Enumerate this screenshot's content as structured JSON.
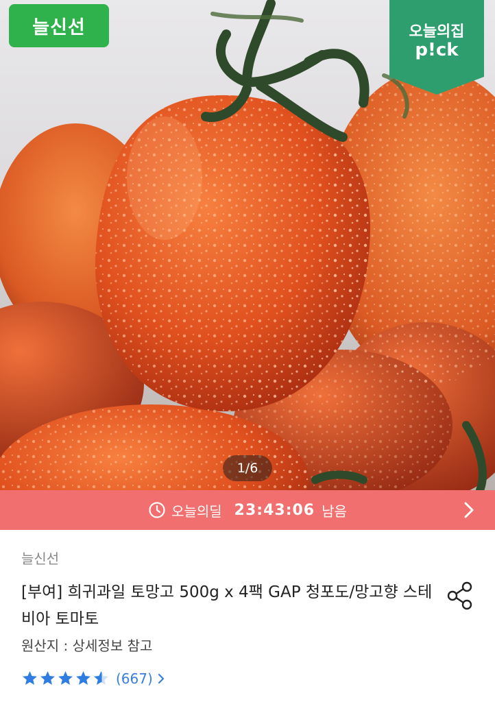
{
  "hero": {
    "brand_tag": "늘신선",
    "pick_badge": {
      "line1": "오늘의집",
      "line2": "p!ck"
    },
    "image_counter": "1/6"
  },
  "deal_bar": {
    "icon": "clock-icon",
    "label": "오늘의딜",
    "countdown": "23:43:06",
    "suffix": "남음",
    "chevron": "chevron-right-icon"
  },
  "product": {
    "brand": "늘신선",
    "title": "[부여] 희귀과일 토망고 500g x 4팩 GAP 청포도/망고향 스테비아 토마토",
    "origin": "원산지 : 상세정보 참고",
    "rating": 4.5,
    "review_count": "(667)",
    "share_icon": "share-icon"
  },
  "colors": {
    "brand_green": "#2fb24b",
    "pick_green": "#2f9e6f",
    "deal_red": "#f26f6f",
    "link_blue": "#3a7de0"
  }
}
